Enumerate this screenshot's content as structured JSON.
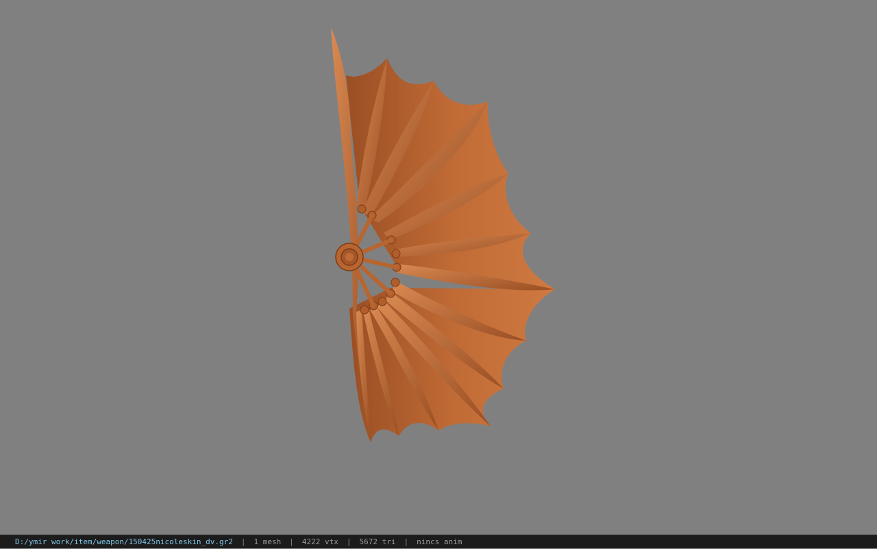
{
  "model": {
    "icon": "wing-shield-model-icon",
    "color": "#c06a35",
    "shade": "#8a4520",
    "highlight": "#d8874e"
  },
  "status": {
    "file_path": "D:/ymir work/item/weapon/150425nicoleskin_dv.gr2",
    "meshes": "1 mesh",
    "vertices": "4222 vtx",
    "triangles": "5672 tri",
    "animation": "nincs anim",
    "separator": "|"
  }
}
